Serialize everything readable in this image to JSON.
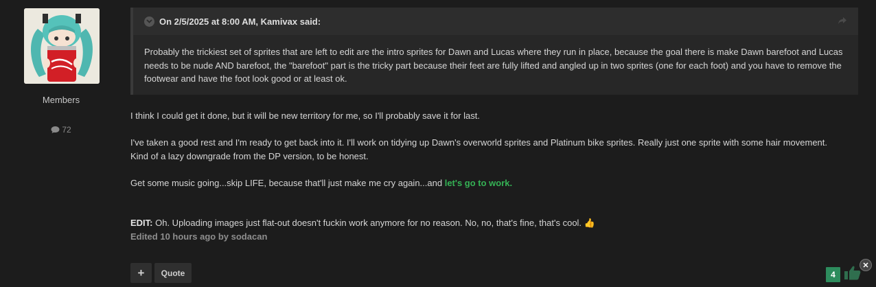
{
  "author": {
    "role": "Members",
    "post_count": "72"
  },
  "quote": {
    "header": "On 2/5/2025 at 8:00 AM, Kamivax said:",
    "body": "Probably the trickiest set of sprites that are left to edit are the intro sprites for Dawn and Lucas where they run in place, because the goal there is make Dawn barefoot and Lucas needs to be nude AND barefoot, the \"barefoot\" part is the tricky part because their feet are fully lifted and angled up in two sprites (one for each foot) and you have to remove the footwear and have the foot look good or at least ok."
  },
  "post": {
    "p1": "I think I could get it done, but it will be new territory for me, so I'll probably save it for last.",
    "p2": "I've taken a good rest and I'm ready to get back into it. I'll work on tidying up Dawn's overworld sprites and Platinum bike sprites. Really just one sprite with some hair movement. Kind of a lazy downgrade from the DP version, to be honest.",
    "p3_text": "Get some music going...skip LIFE, because that'll just make me cry again...and ",
    "p3_highlight": "let's go to work.",
    "edit_label": "EDIT:",
    "edit_text": " Oh. Uploading images just flat-out doesn't fuckin work anymore for no reason. No, no, that's fine, that's cool. ",
    "edit_emoji": "👍",
    "edited_note": "Edited 10 hours ago by sodacan"
  },
  "actions": {
    "plus_label": "+",
    "quote_label": "Quote"
  },
  "reactions": {
    "count": "4"
  },
  "colors": {
    "accent_green": "#35b255",
    "reaction_badge": "#2d8c5d"
  }
}
